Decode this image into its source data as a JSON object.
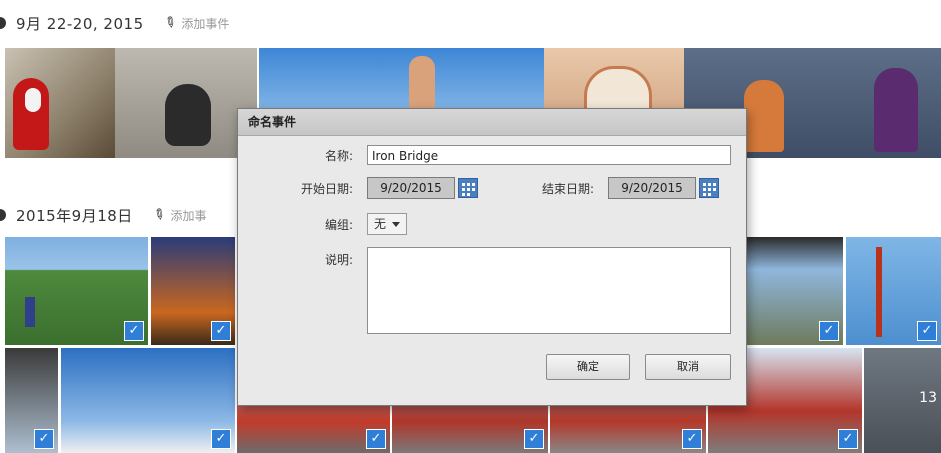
{
  "groups": [
    {
      "date": "9月 22-20, 2015",
      "add_event": "添加事件"
    },
    {
      "date": "2015年9月18日",
      "add_event": "添加事"
    }
  ],
  "photo_counter": "13",
  "dialog": {
    "title": "命名事件",
    "name_label": "名称:",
    "name_value": "Iron Bridge",
    "start_label": "开始日期:",
    "start_value": "9/20/2015",
    "end_label": "结束日期:",
    "end_value": "9/20/2015",
    "group_label": "编组:",
    "group_value": "无",
    "desc_label": "说明:",
    "desc_value": "",
    "ok_label": "确定",
    "cancel_label": "取消"
  },
  "colors": {
    "accent": "#2f7fd8",
    "calendar": "#4a7fc1"
  }
}
